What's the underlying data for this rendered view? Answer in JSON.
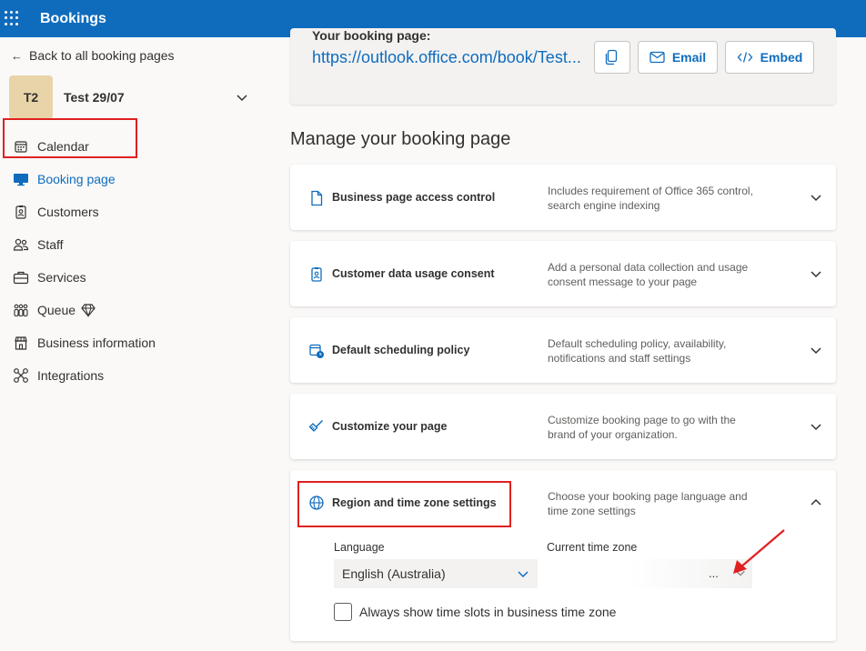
{
  "app": {
    "title": "Bookings"
  },
  "sidebar": {
    "back_label": "Back to all booking pages",
    "calendar": {
      "initials": "T2",
      "name": "Test 29/07"
    },
    "items": [
      {
        "label": "Calendar",
        "icon": "calendar-icon"
      },
      {
        "label": "Booking page",
        "icon": "monitor-icon",
        "active": true
      },
      {
        "label": "Customers",
        "icon": "contact-card-icon"
      },
      {
        "label": "Staff",
        "icon": "people-icon"
      },
      {
        "label": "Services",
        "icon": "briefcase-icon"
      },
      {
        "label": "Queue",
        "icon": "queue-icon",
        "badge_icon": "diamond-icon"
      },
      {
        "label": "Business information",
        "icon": "building-icon"
      },
      {
        "label": "Integrations",
        "icon": "integrations-icon"
      }
    ]
  },
  "booking_link": {
    "label": "Your booking page:",
    "url": "https://outlook.office.com/book/Test...",
    "email_label": "Email",
    "embed_label": "Embed"
  },
  "manage": {
    "title": "Manage your booking page",
    "cards": [
      {
        "title": "Business page access control",
        "desc": "Includes requirement of Office 365 control, search engine indexing",
        "icon": "document-icon",
        "expanded": false
      },
      {
        "title": "Customer data usage consent",
        "desc": "Add a personal data collection and usage consent message to your page",
        "icon": "contact-card-icon",
        "expanded": false
      },
      {
        "title": "Default scheduling policy",
        "desc": "Default scheduling policy, availability, notifications and staff settings",
        "icon": "calendar-clock-icon",
        "expanded": false
      },
      {
        "title": "Customize your page",
        "desc": "Customize booking page to go with the brand of your organization.",
        "icon": "paintbrush-icon",
        "expanded": false
      },
      {
        "title": "Region and time zone settings",
        "desc": "Choose your booking page language and time zone settings",
        "icon": "globe-icon",
        "expanded": true
      }
    ]
  },
  "region": {
    "language_label": "Language",
    "language_value": "English (Australia)",
    "timezone_label": "Current time zone",
    "timezone_value": "...",
    "checkbox_label": "Always show time slots in business time zone",
    "checkbox_checked": false
  },
  "colors": {
    "brand": "#0f6cbd",
    "highlight": "#e02020"
  }
}
